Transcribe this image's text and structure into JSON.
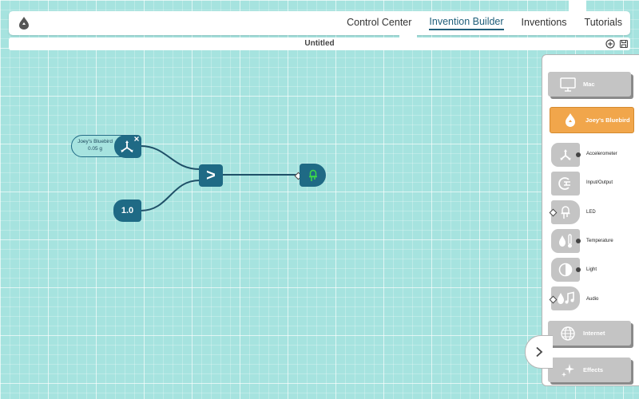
{
  "nav": {
    "tabs": [
      {
        "label": "Control Center"
      },
      {
        "label": "Invention Builder"
      },
      {
        "label": "Inventions"
      },
      {
        "label": "Tutorials"
      }
    ],
    "active_tab": "Invention Builder"
  },
  "document": {
    "title": "Untitled"
  },
  "canvas": {
    "source_block": {
      "name": "Joey's Bluebird",
      "value": "0.05 g"
    },
    "constant_block": {
      "value": "1.0"
    },
    "compare_block": {
      "symbol": ">"
    }
  },
  "sidebar": {
    "categories": {
      "mac": "Mac",
      "device": "Joey's Bluebird",
      "internet": "Internet",
      "effects": "Effects"
    },
    "devices": [
      {
        "label": "Accelerometer"
      },
      {
        "label": "Input/Output"
      },
      {
        "label": "LED"
      },
      {
        "label": "Temperature"
      },
      {
        "label": "Light"
      },
      {
        "label": "Audio"
      }
    ]
  },
  "colors": {
    "canvas_bg": "#a6e3df",
    "block": "#1f6a85",
    "accent_orange": "#f1a64b",
    "led_green": "#3ddc45"
  }
}
